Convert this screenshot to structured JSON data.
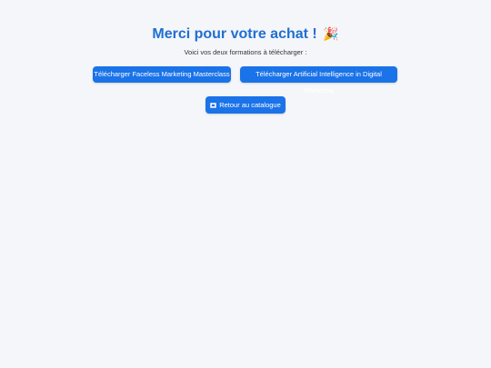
{
  "header": {
    "title": "Merci pour votre achat !",
    "title_emoji": "🎉",
    "subtitle": "Voici vos deux formations à télécharger :"
  },
  "downloads": [
    {
      "label": "Télécharger Faceless Marketing Masterclass"
    },
    {
      "label": "Télécharger Artificial Intelligence in Digital Marketing"
    }
  ],
  "back_button": {
    "label": "Retour au catalogue",
    "icon": "back-box-icon"
  },
  "colors": {
    "accent": "#1a73e8",
    "title": "#1f6fd1",
    "background": "#f4f6fa",
    "text": "#333333"
  }
}
